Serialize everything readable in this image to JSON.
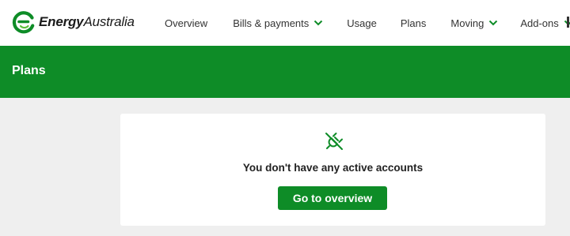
{
  "header": {
    "logo": {
      "text_bold": "Energy",
      "text_regular": "Australia"
    },
    "nav": [
      {
        "label": "Overview",
        "has_dropdown": false
      },
      {
        "label": "Bills & payments",
        "has_dropdown": true
      },
      {
        "label": "Usage",
        "has_dropdown": false
      },
      {
        "label": "Plans",
        "has_dropdown": false
      },
      {
        "label": "Moving",
        "has_dropdown": true
      },
      {
        "label": "Add-ons",
        "has_dropdown": true
      }
    ]
  },
  "banner": {
    "title": "Plans"
  },
  "card": {
    "icon": "unplugged-icon",
    "message": "You don't have any active accounts",
    "button_label": "Go to overview"
  },
  "colors": {
    "brand_green": "#0e8c27",
    "page_background": "#efefef",
    "card_background": "#ffffff"
  }
}
